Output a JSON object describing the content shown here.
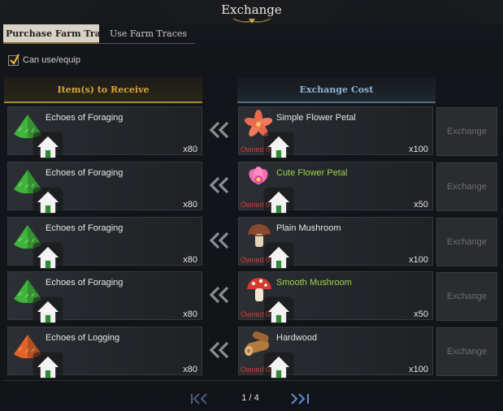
{
  "window": {
    "title": "Exchange"
  },
  "tabs": [
    {
      "label": "Purchase Farm Trac",
      "active": true
    },
    {
      "label": "Use Farm Traces",
      "active": false
    }
  ],
  "filter": {
    "label": "Can use/equip",
    "checked": true
  },
  "headers": {
    "receive": "Item(s) to Receive",
    "cost": "Exchange Cost"
  },
  "rows": [
    {
      "receive": {
        "name": "Echoes of Foraging",
        "qty": "x80",
        "icon": "foraging-pile-icon",
        "color": "#3fb33b"
      },
      "cost": {
        "name": "Simple Flower Petal",
        "qty": "x100",
        "owned": "Owned 0",
        "icon": "simple-flower-icon",
        "highlight": false
      },
      "button": "Exchange"
    },
    {
      "receive": {
        "name": "Echoes of Foraging",
        "qty": "x80",
        "icon": "foraging-pile-icon",
        "color": "#3fb33b"
      },
      "cost": {
        "name": "Cute Flower Petal",
        "qty": "x50",
        "owned": "Owned 0",
        "icon": "cute-flower-icon",
        "highlight": true
      },
      "button": "Exchange"
    },
    {
      "receive": {
        "name": "Echoes of Foraging",
        "qty": "x80",
        "icon": "foraging-pile-icon",
        "color": "#3fb33b"
      },
      "cost": {
        "name": "Plain Mushroom",
        "qty": "x100",
        "owned": "Owned 0",
        "icon": "plain-mushroom-icon",
        "highlight": false
      },
      "button": "Exchange"
    },
    {
      "receive": {
        "name": "Echoes of Foraging",
        "qty": "x80",
        "icon": "foraging-pile-icon",
        "color": "#3fb33b"
      },
      "cost": {
        "name": "Smooth Mushroom",
        "qty": "x50",
        "owned": "Owned 0",
        "icon": "smooth-mushroom-icon",
        "highlight": true
      },
      "button": "Exchange"
    },
    {
      "receive": {
        "name": "Echoes of Logging",
        "qty": "x80",
        "icon": "logging-pile-icon",
        "color": "#e0642a"
      },
      "cost": {
        "name": "Hardwood",
        "qty": "x100",
        "owned": "Owned 0",
        "icon": "hardwood-icon",
        "highlight": false
      },
      "button": "Exchange"
    }
  ],
  "pagination": {
    "label": "1 / 4"
  },
  "colors": {
    "accent_gold": "#d7a63a",
    "accent_blue": "#8fb3d0",
    "owned_red": "#d93a32",
    "highlight_green": "#9ed64a"
  }
}
